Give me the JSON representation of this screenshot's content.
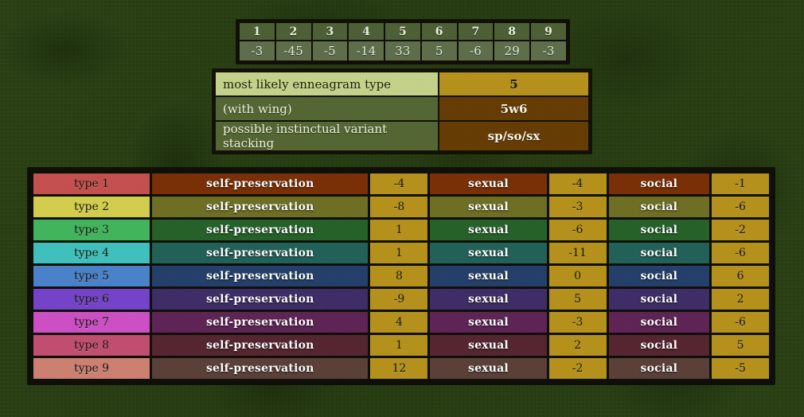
{
  "score_table": {
    "types": [
      "1",
      "2",
      "3",
      "4",
      "5",
      "6",
      "7",
      "8",
      "9"
    ],
    "scores": [
      "-3",
      "-45",
      "-5",
      "-14",
      "33",
      "5",
      "-6",
      "29",
      "-3"
    ]
  },
  "summary": {
    "rows": [
      {
        "label": "most likely enneagram type",
        "value": "5"
      },
      {
        "label": "(with wing)",
        "value": "5w6"
      },
      {
        "label": "possible instinctual variant stacking",
        "value": "sp/so/sx"
      }
    ]
  },
  "types_table": {
    "instinct_labels": {
      "self_preservation": "self-preservation",
      "sexual": "sexual",
      "social": "social"
    },
    "rows": [
      {
        "type": "type 1",
        "color": "#c4504e",
        "dark": "#7a3006",
        "sp": "-4",
        "sx": "-4",
        "so": "-1"
      },
      {
        "type": "type 2",
        "color": "#d3cd4d",
        "dark": "#6e6e24",
        "sp": "-8",
        "sx": "-3",
        "so": "-6"
      },
      {
        "type": "type 3",
        "color": "#41b45c",
        "dark": "#256129",
        "sp": "1",
        "sx": "-6",
        "so": "-2"
      },
      {
        "type": "type 4",
        "color": "#3fc0bd",
        "dark": "#226158",
        "sp": "1",
        "sx": "-11",
        "so": "-6"
      },
      {
        "type": "type 5",
        "color": "#4a82ca",
        "dark": "#24406a",
        "sp": "8",
        "sx": "0",
        "so": "6"
      },
      {
        "type": "type 6",
        "color": "#7443c8",
        "dark": "#3e2d66",
        "sp": "-9",
        "sx": "5",
        "so": "2"
      },
      {
        "type": "type 7",
        "color": "#cc4fc4",
        "dark": "#5f2456",
        "sp": "4",
        "sx": "-3",
        "so": "-6"
      },
      {
        "type": "type 8",
        "color": "#c14e70",
        "dark": "#562630",
        "sp": "1",
        "sx": "2",
        "so": "5"
      },
      {
        "type": "type 9",
        "color": "#cc8072",
        "dark": "#5a4038",
        "sp": "12",
        "sx": "-2",
        "so": "-5"
      }
    ]
  },
  "colors": {
    "background": "#2e4515",
    "gold": "#b5911c",
    "brown": "#653c04",
    "olive": "#546633",
    "light_green": "#c3d18a",
    "border": "#0e0f07"
  }
}
